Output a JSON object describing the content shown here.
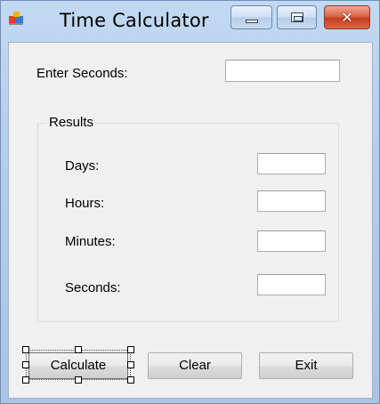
{
  "window": {
    "title": "Time Calculator",
    "controls": {
      "minimize": "minimize",
      "maximize": "maximize",
      "close": "close"
    }
  },
  "input": {
    "enter_seconds_label": "Enter Seconds:",
    "enter_seconds_value": ""
  },
  "results": {
    "group_title": "Results",
    "days_label": "Days:",
    "days_value": "",
    "hours_label": "Hours:",
    "hours_value": "",
    "minutes_label": "Minutes:",
    "minutes_value": "",
    "seconds_label": "Seconds:",
    "seconds_value": ""
  },
  "buttons": {
    "calculate": "Calculate",
    "clear": "Clear",
    "exit": "Exit"
  },
  "icons": {
    "app": "app-icon",
    "minimize": "minimize-icon",
    "maximize": "maximize-icon",
    "close": "close-icon"
  },
  "colors": {
    "titlebar": "#b4cdea",
    "client_background": "#f0f0f0",
    "close_button": "#c43d20"
  }
}
